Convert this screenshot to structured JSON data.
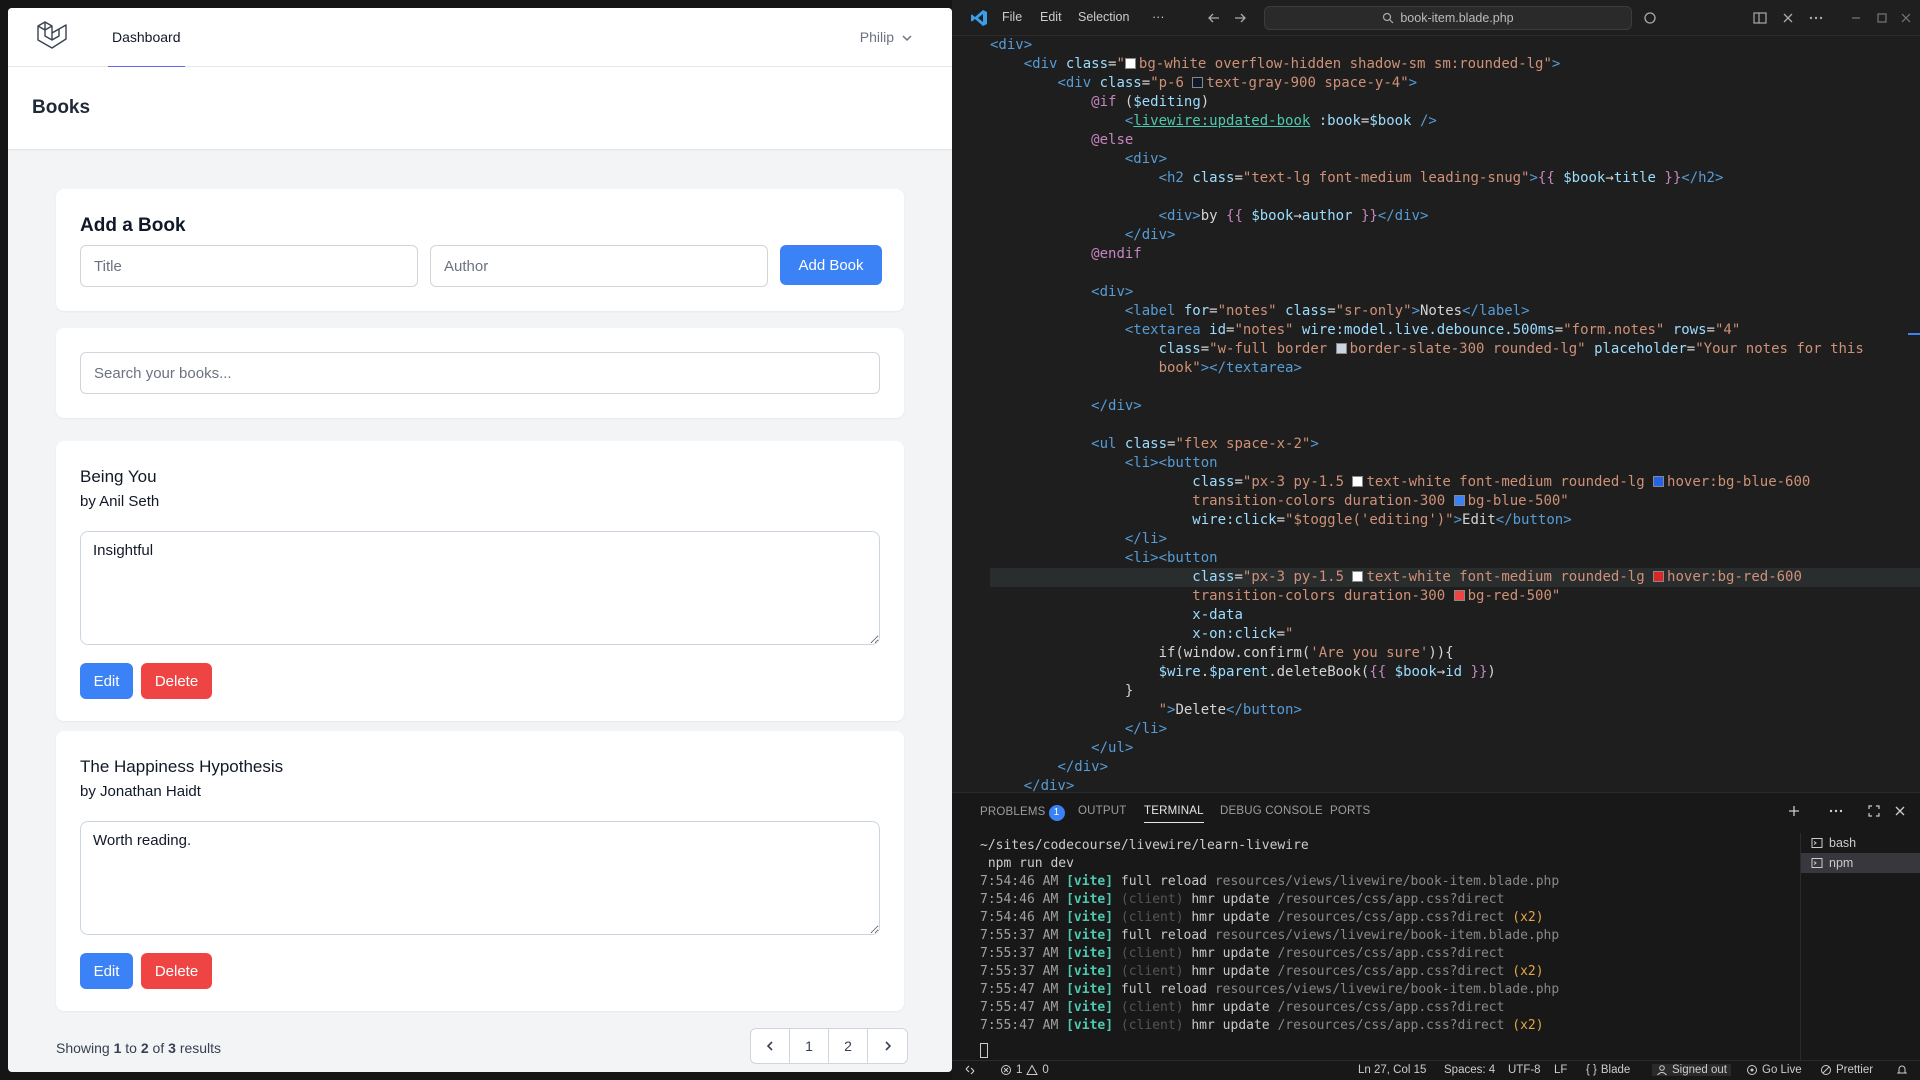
{
  "app": {
    "nav": {
      "dashboard": "Dashboard",
      "user": "Philip"
    },
    "page_title": "Books",
    "add_form": {
      "title": "Add a Book",
      "title_placeholder": "Title",
      "author_placeholder": "Author",
      "submit": "Add Book"
    },
    "search_placeholder": "Search your books...",
    "books": [
      {
        "title": "Being You",
        "author": "by Anil Seth",
        "notes": "Insightful",
        "edit": "Edit",
        "delete": "Delete"
      },
      {
        "title": "The Happiness Hypothesis",
        "author": "by Jonathan Haidt",
        "notes": "Worth reading.",
        "edit": "Edit",
        "delete": "Delete"
      }
    ],
    "pagination": {
      "showing": "Showing",
      "from": "1",
      "to_word": "to",
      "to": "2",
      "of_word": "of",
      "total": "3",
      "results": "results",
      "pages": [
        "1",
        "2"
      ]
    },
    "colors": {
      "primary": "#3b82f6",
      "danger": "#ef4444",
      "nav_active": "#6366f1"
    }
  },
  "vscode": {
    "menu": {
      "file": "File",
      "edit": "Edit",
      "selection": "Selection",
      "more": "···"
    },
    "search": "book-item.blade.php",
    "panel_tabs": {
      "problems": "PROBLEMS",
      "problems_count": "1",
      "output": "OUTPUT",
      "terminal": "TERMINAL",
      "debug": "DEBUG CONSOLE",
      "ports": "PORTS"
    },
    "terminal_list": [
      "bash",
      "npm"
    ],
    "terminal": {
      "cwd": "~/sites/codecourse/livewire/learn-livewire",
      "cmd": " npm run dev"
    },
    "status": {
      "errors": "1",
      "warnings": "0",
      "position": "Ln 27, Col 15",
      "spaces": "Spaces: 4",
      "encoding": "UTF-8",
      "eol": "LF",
      "language": "Blade",
      "account": "Signed out",
      "golive": "Go Live",
      "prettier": "Prettier"
    }
  }
}
